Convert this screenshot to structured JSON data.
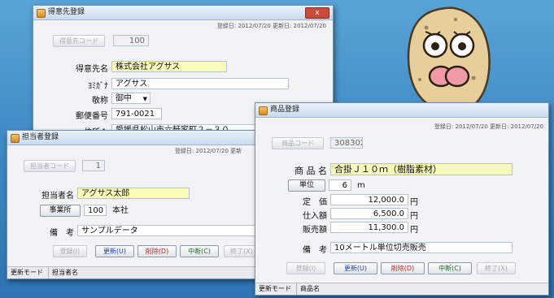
{
  "win1": {
    "title": "得意先登録",
    "close": "x",
    "dates": "登録日: 2012/07/20  更新日: 2012/07/20",
    "code_label": "得意先コード",
    "code_value": "100",
    "name_label": "得意先名",
    "name_value": "株式会社アグサス",
    "kana_label": "ﾖﾐｶﾞﾅ",
    "kana_value": "アグサス",
    "honorific_label": "敬称",
    "honorific_value": "御中",
    "zip_label": "郵便番号",
    "zip_value": "791-0021",
    "addr_label": "住所１",
    "addr_value": "愛媛県松山市六軒家町２－３０"
  },
  "win2": {
    "title": "担当者登録",
    "dates": "登録日: 2012/07/20  更新",
    "code_label": "担当者コード",
    "code_value": "1",
    "name_label": "担当者名",
    "name_value": "アグサス太郎",
    "office_btn": "事業所",
    "office_code": "100",
    "office_name": "本社",
    "note_label": "備　考",
    "note_value": "サンプルデータ",
    "buttons": [
      "登録(I)",
      "更新(U)",
      "削除(D)",
      "中断(C)",
      "終了(X)"
    ],
    "status": [
      "更新モード",
      "担当者名"
    ]
  },
  "win3": {
    "title": "商品登録",
    "dates": "登録日: 2012/07/20  更新日: 2012/07/20",
    "code_label": "商品コード",
    "code_value": "308302",
    "name_label": "商 品 名",
    "name_value": "合掛Ｊ１０ｍ（樹脂素材）",
    "unit_btn": "単位",
    "unit_code": "6",
    "unit_name": "m",
    "price_label": "定　価",
    "price_value": "12,000.0",
    "cost_label": "仕入額",
    "cost_value": "6,500.0",
    "sale_label": "販売額",
    "sale_value": "11,300.0",
    "yen": "円",
    "note_label": "備　考",
    "note_value": "10メートル単位切売販売",
    "buttons": [
      "登録(I)",
      "更新(U)",
      "削除(D)",
      "中断(C)",
      "終了(X)"
    ],
    "status": [
      "更新モード",
      "商品名"
    ]
  }
}
